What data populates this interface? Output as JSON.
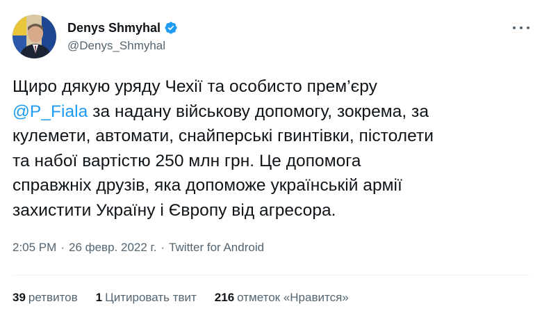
{
  "author": {
    "display_name": "Denys Shmyhal",
    "handle": "@Denys_Shmyhal",
    "verified": true
  },
  "tweet": {
    "lines": [
      {
        "before": "Щиро дякую уряду Чехії та особисто прем’єру",
        "mention": "",
        "after": ""
      },
      {
        "before": "",
        "mention": "@P_Fiala",
        "after": " за надану військову допомогу, зокрема, за"
      },
      {
        "before": "кулемети, автомати, снайперські гвинтівки, пістолети",
        "mention": "",
        "after": ""
      },
      {
        "before": "та набої вартістю 250 млн грн. Це допомога",
        "mention": "",
        "after": ""
      },
      {
        "before": "справжніх друзів, яка допоможе українській армії",
        "mention": "",
        "after": ""
      },
      {
        "before": "захистити Україну і Європу від агресора.",
        "mention": "",
        "after": ""
      }
    ]
  },
  "meta": {
    "time": "2:05 PM",
    "separator": "·",
    "date": "26 февр. 2022 г.",
    "source": "Twitter for Android"
  },
  "stats": {
    "retweets": {
      "count": "39",
      "label": "ретвитов"
    },
    "quotes": {
      "count": "1",
      "label": "Цитировать твит"
    },
    "likes": {
      "count": "216",
      "label": "отметок «Нравится»"
    }
  },
  "colors": {
    "accent": "#1d9bf0",
    "text": "#0f1419",
    "secondary": "#536471"
  },
  "icons": {
    "verified": "verified-badge-icon",
    "more": "more-options-icon"
  }
}
